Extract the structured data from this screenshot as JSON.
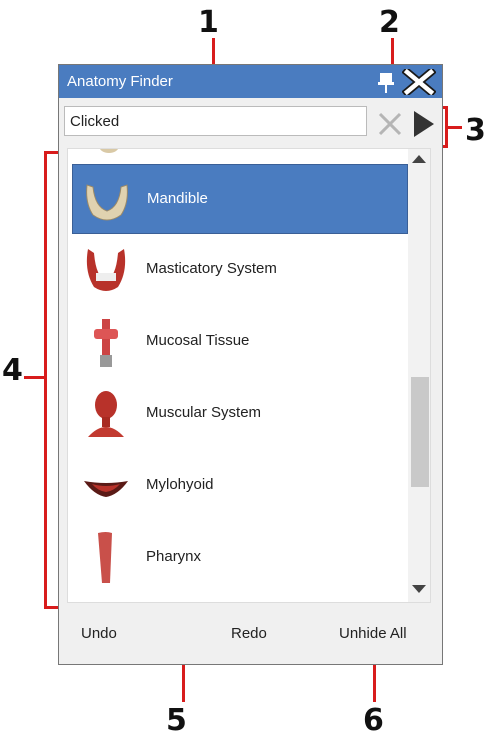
{
  "annotations": [
    "1",
    "2",
    "3",
    "4",
    "5",
    "6"
  ],
  "window": {
    "title": "Anatomy Finder"
  },
  "search": {
    "value": "Clicked"
  },
  "list": {
    "items": [
      {
        "label": "Mandible",
        "selected": true
      },
      {
        "label": "Masticatory System",
        "selected": false
      },
      {
        "label": "Mucosal Tissue",
        "selected": false
      },
      {
        "label": "Muscular System",
        "selected": false
      },
      {
        "label": "Mylohyoid",
        "selected": false
      },
      {
        "label": "Pharynx",
        "selected": false
      }
    ]
  },
  "buttons": {
    "undo": "Undo",
    "redo": "Redo",
    "unhide_all": "Unhide All"
  },
  "colors": {
    "titlebar": "#4a7cc0",
    "annotation": "#d81c1c",
    "selected": "#4a7cc0"
  }
}
